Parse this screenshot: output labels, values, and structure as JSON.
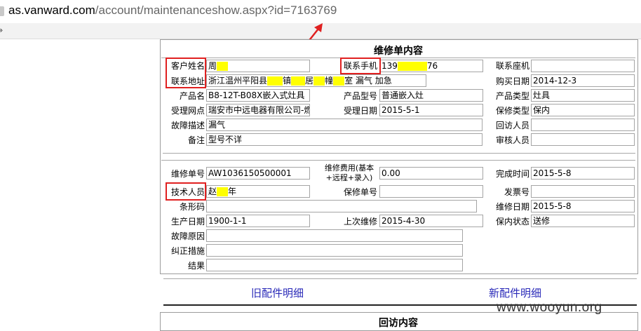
{
  "browser": {
    "url_host": "as.vanward.com",
    "url_path": "/account/maintenanceshow.aspx?id=7163769"
  },
  "form": {
    "title": "维修单内容",
    "labels": {
      "customer_name": "客户姓名",
      "mobile": "联系手机",
      "landline": "联系座机",
      "address": "联系地址",
      "purchase_date": "购买日期",
      "product_name": "产品名",
      "product_model": "产品型号",
      "product_type": "产品类型",
      "service_point": "受理网点",
      "accept_date": "受理日期",
      "warranty_type": "保修类型",
      "fault_desc": "故障描述",
      "visitor": "回访人员",
      "remark": "备注",
      "auditor": "审核人员",
      "repair_no": "维修单号",
      "repair_fee": "维修费用(基本+远程+录入)",
      "finish_time": "完成时间",
      "technician": "技术人员",
      "warranty_no": "保修单号",
      "invoice_no": "发票号",
      "barcode": "条形码",
      "repair_date": "维修日期",
      "production_date": "生产日期",
      "last_repair": "上次维修",
      "warranty_status": "保内状态",
      "fault_reason": "故障原因",
      "corrective": "纠正措施",
      "result": "结果"
    },
    "values": {
      "customer_name_a": "周",
      "mobile_a": "139",
      "mobile_b": "76",
      "landline": "",
      "address_a": "浙江温州平阳县",
      "address_b": "镇",
      "address_c": "居",
      "address_d": "幢",
      "address_e": "室 漏气 加急",
      "purchase_date": "2014-12-3",
      "product_name": "B8-12T-B08X嵌入式灶具",
      "product_model": "普通嵌入灶",
      "product_type": "灶具",
      "service_point": "瑞安市中远电器有限公司-燃",
      "accept_date": "2015-5-1",
      "warranty_type": "保内",
      "fault_desc": "漏气",
      "visitor": "",
      "remark": "型号不详",
      "auditor": "",
      "repair_no": "AW1036150500001",
      "repair_fee": "0.00",
      "finish_time": "2015-5-8",
      "technician_a": "赵",
      "technician_b": "年",
      "warranty_no": "",
      "invoice_no": "",
      "barcode": "",
      "repair_date": "2015-5-8",
      "production_date": "1900-1-1",
      "last_repair": "2015-4-30",
      "warranty_status": "送修",
      "fault_reason": "",
      "corrective": "",
      "result": ""
    }
  },
  "links": {
    "old_parts": "旧配件明细",
    "new_parts": "新配件明细"
  },
  "visit_section": {
    "title": "回访内容"
  },
  "watermark": "www.wooyun.org",
  "colors": {
    "highlight": "#ffff00",
    "annotation_red": "#e02020",
    "link": "#2a2ab8"
  }
}
